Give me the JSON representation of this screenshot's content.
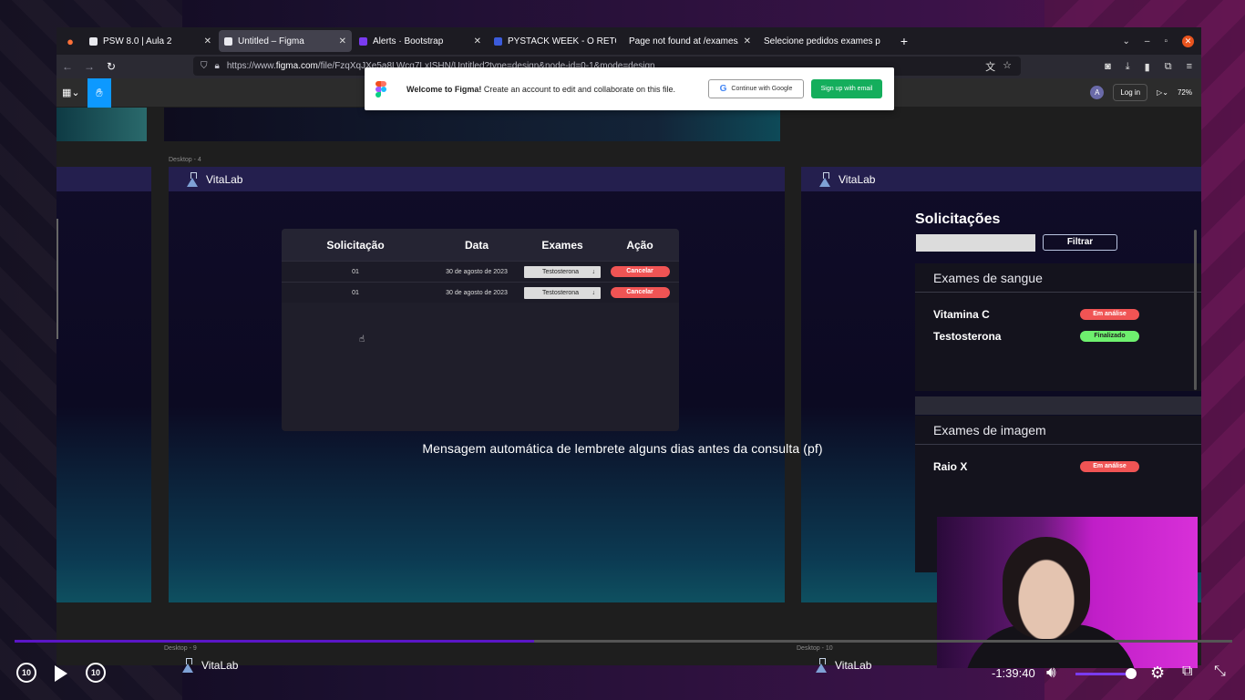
{
  "browser": {
    "tabs": [
      {
        "title": "PSW 8.0 | Aula 2",
        "icon": "document-icon"
      },
      {
        "title": "Untitled – Figma",
        "icon": "figma-icon"
      },
      {
        "title": "Alerts · Bootstrap",
        "icon": "bootstrap-icon"
      },
      {
        "title": "PYSTACK WEEK - O RETO",
        "icon": "pystack-icon"
      },
      {
        "title": "Page not found at /exames/",
        "icon": "none"
      },
      {
        "title": "Selecione pedidos exames p",
        "icon": "none"
      }
    ],
    "url_prefix": "https://www.",
    "url_domain": "figma.com",
    "url_rest": "/file/FzqXqJXe5a8LWcq7LxISHN/Untitled?type=design&node-id=0-1&mode=design"
  },
  "figma": {
    "title": "Untitled",
    "avatar": "A",
    "login": "Log in",
    "zoom": "72%",
    "banner": {
      "bold": "Welcome to Figma!",
      "text": " Create an account to edit and collaborate on this file.",
      "google_btn": "Continue with Google",
      "email_btn": "Sign up with email"
    },
    "frame_labels": {
      "desktop4": "Desktop - 4",
      "desktop9": "Desktop - 9",
      "desktop10": "Desktop - 10"
    },
    "brand": "VitaLab"
  },
  "table": {
    "headers": [
      "Solicitação",
      "Data",
      "Exames",
      "Ação"
    ],
    "rows": [
      {
        "id": "01",
        "date": "30 de agosto de 2023",
        "exam": "Testosterona",
        "action": "Cancelar"
      },
      {
        "id": "01",
        "date": "30 de agosto de 2023",
        "exam": "Testosterona",
        "action": "Cancelar"
      }
    ]
  },
  "caption": "Mensagem automática de lembrete alguns dias antes da consulta (pf)",
  "solicitacoes": {
    "title": "Solicitações",
    "filter_btn": "Filtrar",
    "blood_title": "Exames de sangue",
    "blood_items": [
      {
        "name": "Vitamina C",
        "status": "Em análise"
      },
      {
        "name": "Testosterona",
        "status": "Finalizado"
      }
    ],
    "image_title": "Exames de imagem",
    "image_items": [
      {
        "name": "Raio X",
        "status": "Em análise"
      }
    ]
  },
  "player": {
    "time": "-1:39:40",
    "skip_back": "10",
    "skip_fwd": "10",
    "progress": 0.427,
    "volume": 0.9
  }
}
